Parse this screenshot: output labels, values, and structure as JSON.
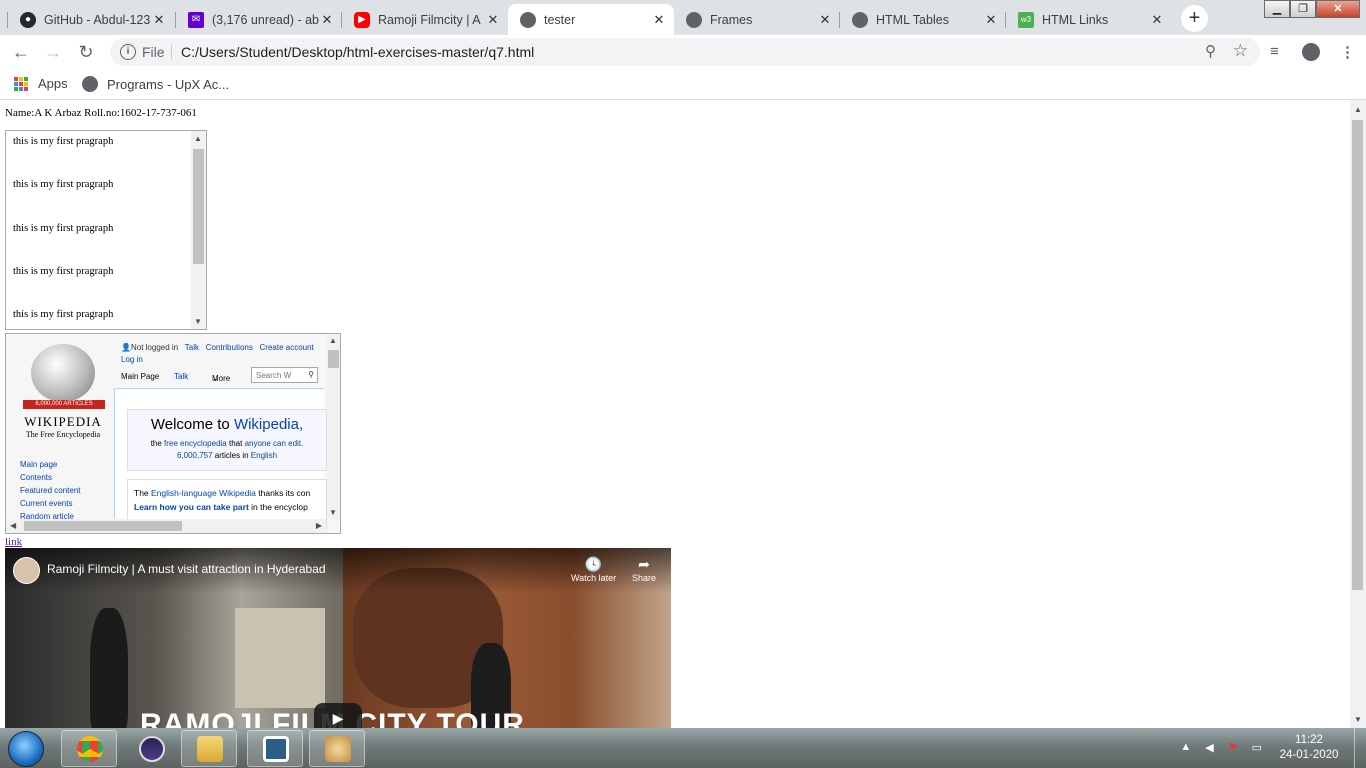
{
  "browser": {
    "tabs": [
      {
        "title": "GitHub - Abdul-123",
        "favicon": "github-icon",
        "color": "#24292e"
      },
      {
        "title": "(3,176 unread) - ab",
        "favicon": "yahoo-mail-icon",
        "color": "#6001d2"
      },
      {
        "title": "Ramoji Filmcity | A",
        "favicon": "youtube-icon",
        "color": "#ff0000"
      },
      {
        "title": "tester",
        "favicon": "globe-icon",
        "color": "#5f6368"
      },
      {
        "title": "Frames",
        "favicon": "globe-icon",
        "color": "#5f6368"
      },
      {
        "title": "HTML Tables",
        "favicon": "globe-icon",
        "color": "#5f6368"
      },
      {
        "title": "HTML Links",
        "favicon": "w3schools-icon",
        "color": "#4caf50"
      }
    ],
    "active_tab": 3,
    "address": {
      "scheme_label": "File",
      "url": "C:/Users/Student/Desktop/html-exercises-master/q7.html"
    },
    "bookmarks": [
      {
        "label": "Apps",
        "icon": "apps-grid-icon"
      },
      {
        "label": "Programs - UpX Ac...",
        "icon": "globe-icon"
      }
    ]
  },
  "page": {
    "name_line": "Name:A K Arbaz Roll.no:1602-17-737-061",
    "frame1": {
      "paragraphs": [
        "this is my first pragraph",
        "this is my first pragraph",
        "this is my first pragraph",
        "this is my first pragraph",
        "this is my first pragraph"
      ]
    },
    "wikipedia": {
      "badge": "6,000,000 ARTICLES",
      "wordmark": "WIKIPEDIA",
      "tagline": "The Free Encyclopedia",
      "user_links": {
        "not_logged_in": "Not logged in",
        "talk": "Talk",
        "contributions": "Contributions",
        "create_account": "Create account",
        "log_in": "Log in"
      },
      "tabs": {
        "main_page": "Main Page",
        "talk": "Talk",
        "more": "More"
      },
      "search_placeholder": "Search W",
      "nav": [
        "Main page",
        "Contents",
        "Featured content",
        "Current events",
        "Random article"
      ],
      "welcome": {
        "prefix": "Welcome to ",
        "brand": "Wikipedia,",
        "line2_a": "the ",
        "line2_link1": "free encyclopedia",
        "line2_b": " that ",
        "line2_link2": "anyone can edit.",
        "count": "6,000,757",
        "count_suffix": " articles in ",
        "lang": "English"
      },
      "note": {
        "l1_a": "The ",
        "l1_link": "English-language Wikipedia",
        "l1_b": " thanks its con",
        "l2_bold": "Learn how you can take part",
        "l2_b": " in the encyclop"
      }
    },
    "link_text": "link",
    "video": {
      "title": "Ramoji Filmcity | A must visit attraction in Hyderabad",
      "watch_later": "Watch later",
      "share": "Share",
      "overlay_text": "RAMOJI FILM CITY TOUR"
    }
  },
  "taskbar": {
    "apps": [
      "chrome-icon",
      "eclipse-icon",
      "folder-icon",
      "vscode-icon",
      "paint-icon"
    ],
    "time": "11:22",
    "date": "24-01-2020"
  }
}
